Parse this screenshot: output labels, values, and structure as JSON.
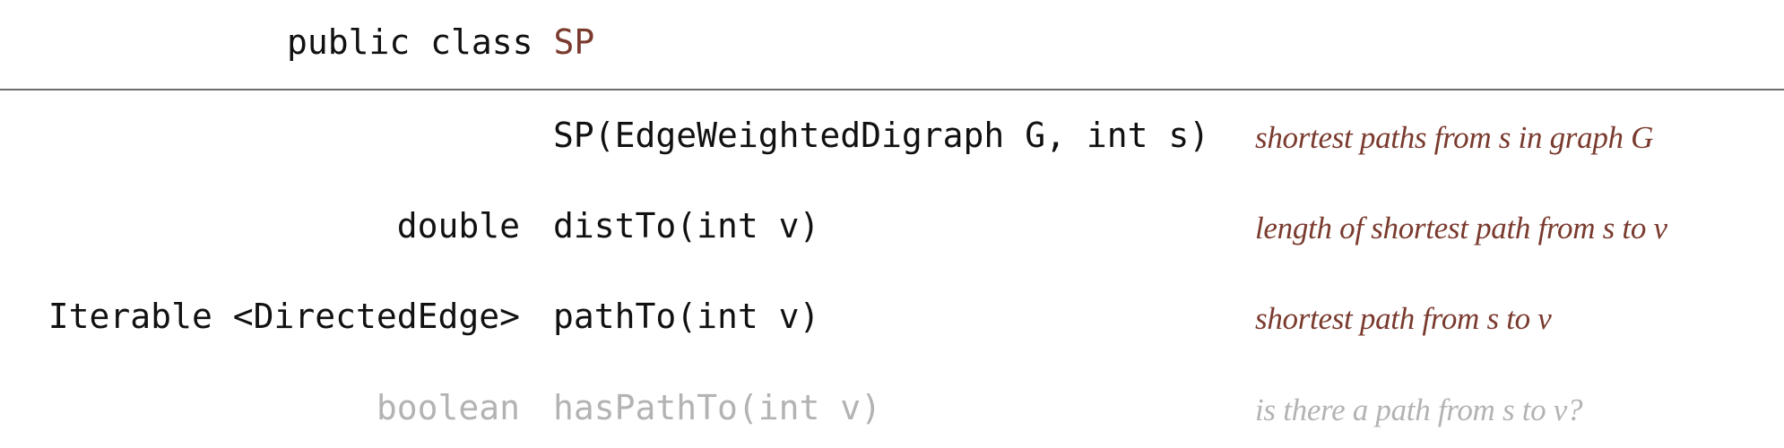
{
  "header": {
    "prefix": "public class",
    "class_name": "SP"
  },
  "api_rows": [
    {
      "return_type": "",
      "signature": "SP(EdgeWeightedDigraph G, int s)",
      "description": "shortest paths from s in graph G",
      "faded": false
    },
    {
      "return_type": "double",
      "signature": "distTo(int v)",
      "description": "length of shortest path from s to v",
      "faded": false
    },
    {
      "return_type": "Iterable <DirectedEdge>",
      "signature": "pathTo(int v)",
      "description": "shortest path from s to v",
      "faded": false
    },
    {
      "return_type": "boolean",
      "signature": "hasPathTo(int v)",
      "description": "is there a path from s to v?",
      "faded": true
    }
  ],
  "colors": {
    "text": "#111111",
    "accent": "#7a3a2e",
    "faded": "#b3b3b3",
    "rule": "#6b6b6b"
  }
}
